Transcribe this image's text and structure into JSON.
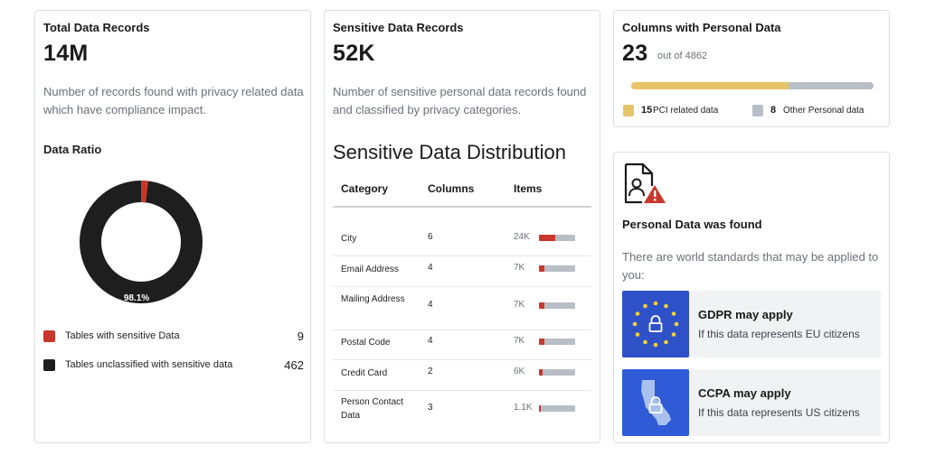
{
  "total_records": {
    "title": "Total Data Records",
    "value": "14M",
    "description": "Number of records found with privacy related data which have compliance impact."
  },
  "data_ratio": {
    "title": "Data Ratio",
    "donut_center_label": "98.1%",
    "unclassified_fraction": 0.981,
    "legend": [
      {
        "label": "Tables with sensitive Data",
        "count": "9",
        "color": "#c9372c"
      },
      {
        "label": "Tables unclassified with sensitive data",
        "count": "462",
        "color": "#1e1e1e"
      }
    ]
  },
  "sensitive_records": {
    "title": "Sensitive Data Records",
    "value": "52K",
    "description": "Number of sensitive personal data records found and classified by privacy categories."
  },
  "distribution": {
    "title": "Sensitive Data Distribution",
    "headers": {
      "category": "Category",
      "columns": "Columns",
      "items": "Items"
    },
    "rows": [
      {
        "category": "City",
        "columns": "6",
        "items": "24K",
        "fraction": 0.46
      },
      {
        "category": "Email Address",
        "columns": "4",
        "items": "7K",
        "fraction": 0.14
      },
      {
        "category": "Mailing Address",
        "columns": "4",
        "items": "7K",
        "fraction": 0.14
      },
      {
        "category": "Postal Code",
        "columns": "4",
        "items": "7K",
        "fraction": 0.14
      },
      {
        "category": "Credit Card",
        "columns": "2",
        "items": "6K",
        "fraction": 0.11
      },
      {
        "category": "Person Contact Data",
        "columns": "3",
        "items": "1.1K",
        "fraction": 0.03
      }
    ]
  },
  "personal_columns": {
    "title": "Columns with Personal Data",
    "value": "23",
    "out_of": "out of 4862",
    "pci_fraction": 0.65,
    "legend": [
      {
        "num": "15",
        "label": "PCI related data",
        "color": "#e8c468"
      },
      {
        "num": "8",
        "label": "Other Personal data",
        "color": "#b8bec6"
      }
    ]
  },
  "personal_found": {
    "icon": "document-warning-icon",
    "title": "Personal Data was found",
    "description": "There are world standards that may be applied to you:",
    "regulations": [
      {
        "title": "GDPR may apply",
        "subtitle": "If this data represents EU citizens",
        "icon": "eu-flag-lock-icon",
        "color": "#2f51c8"
      },
      {
        "title": "CCPA may apply",
        "subtitle": "If this data represents US citizens",
        "icon": "california-lock-icon",
        "color": "#2f5bd6"
      }
    ]
  }
}
